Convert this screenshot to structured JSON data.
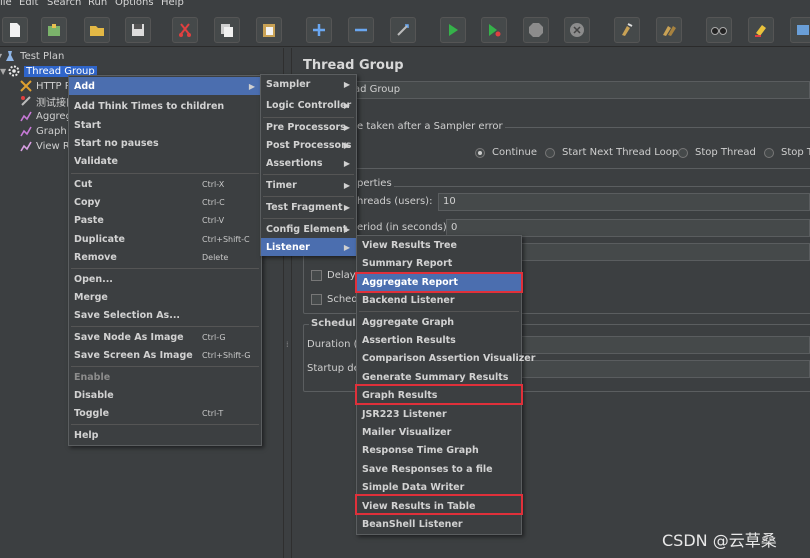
{
  "menubar": {
    "items": [
      "ile",
      "Edit",
      "Search",
      "Run",
      "Options",
      "Help"
    ]
  },
  "toolbar": {
    "icons": [
      "new-icon",
      "templates-icon",
      "open-icon",
      "save-icon",
      "cut-icon",
      "copy-icon",
      "paste-icon",
      "expand-icon",
      "collapse-icon",
      "toggle-icon",
      "start-icon",
      "start-no-pauses-icon",
      "stop-icon",
      "shutdown-icon",
      "clear-icon",
      "clear-all-icon",
      "search-icon",
      "reset-search-icon",
      "function-helper-icon"
    ]
  },
  "tree": {
    "items": [
      {
        "label": "Test Plan",
        "icon": "test-plan-icon"
      },
      {
        "label": "Thread Group",
        "icon": "gear-icon"
      },
      {
        "label": "HTTP R",
        "icon": "sampler-icon"
      },
      {
        "label": "测试接口",
        "icon": "assertion-icon"
      },
      {
        "label": "Aggreg",
        "icon": "chart-icon"
      },
      {
        "label": "Graph R",
        "icon": "chart-icon"
      },
      {
        "label": "View Re",
        "icon": "listener-icon"
      }
    ]
  },
  "panel": {
    "title": "Thread Group",
    "name_value": "ad Group",
    "error_action_legend": "e taken after a Sampler error",
    "radios": [
      "Continue",
      "Start Next Thread Loop",
      "Stop Thread",
      "Stop Te"
    ],
    "properties_legend": "perties",
    "threads_label": "hreads (users):",
    "threads_value": "10",
    "rampup_label": "eriod (in seconds):",
    "rampup_value": "0",
    "delay_label": "Delay",
    "sched_label": "Sched",
    "scheduler_label": "Scheduler",
    "duration_label": "Duration (s",
    "startup_label": "Startup del"
  },
  "context_menu": {
    "items": [
      {
        "label": "Add",
        "shortcut": ""
      },
      {
        "label": "Add Think Times to children",
        "shortcut": ""
      },
      {
        "label": "Start",
        "shortcut": ""
      },
      {
        "label": "Start no pauses",
        "shortcut": ""
      },
      {
        "label": "Validate",
        "shortcut": ""
      },
      {
        "label": "Cut",
        "shortcut": "Ctrl-X"
      },
      {
        "label": "Copy",
        "shortcut": "Ctrl-C"
      },
      {
        "label": "Paste",
        "shortcut": "Ctrl-V"
      },
      {
        "label": "Duplicate",
        "shortcut": "Ctrl+Shift-C"
      },
      {
        "label": "Remove",
        "shortcut": "Delete"
      },
      {
        "label": "Open...",
        "shortcut": ""
      },
      {
        "label": "Merge",
        "shortcut": ""
      },
      {
        "label": "Save Selection As...",
        "shortcut": ""
      },
      {
        "label": "Save Node As Image",
        "shortcut": "Ctrl-G"
      },
      {
        "label": "Save Screen As Image",
        "shortcut": "Ctrl+Shift-G"
      },
      {
        "label": "Enable",
        "shortcut": ""
      },
      {
        "label": "Disable",
        "shortcut": ""
      },
      {
        "label": "Toggle",
        "shortcut": "Ctrl-T"
      },
      {
        "label": "Help",
        "shortcut": ""
      }
    ]
  },
  "add_menu": {
    "items": [
      "Sampler",
      "Logic Controller",
      "Pre Processors",
      "Post Processors",
      "Assertions",
      "Timer",
      "Test Fragment",
      "Config Element",
      "Listener"
    ]
  },
  "listener_menu": {
    "items": [
      "View Results Tree",
      "Summary Report",
      "Aggregate Report",
      "Backend Listener",
      "Aggregate Graph",
      "Assertion Results",
      "Comparison Assertion Visualizer",
      "Generate Summary Results",
      "Graph Results",
      "JSR223 Listener",
      "Mailer Visualizer",
      "Response Time Graph",
      "Save Responses to a file",
      "Simple Data Writer",
      "View Results in Table",
      "BeanShell Listener"
    ]
  },
  "watermark": "CSDN @云草桑",
  "colors": {
    "highlight": "#4b6eaf",
    "annotation": "#e0303a",
    "background": "#3c3f41"
  }
}
